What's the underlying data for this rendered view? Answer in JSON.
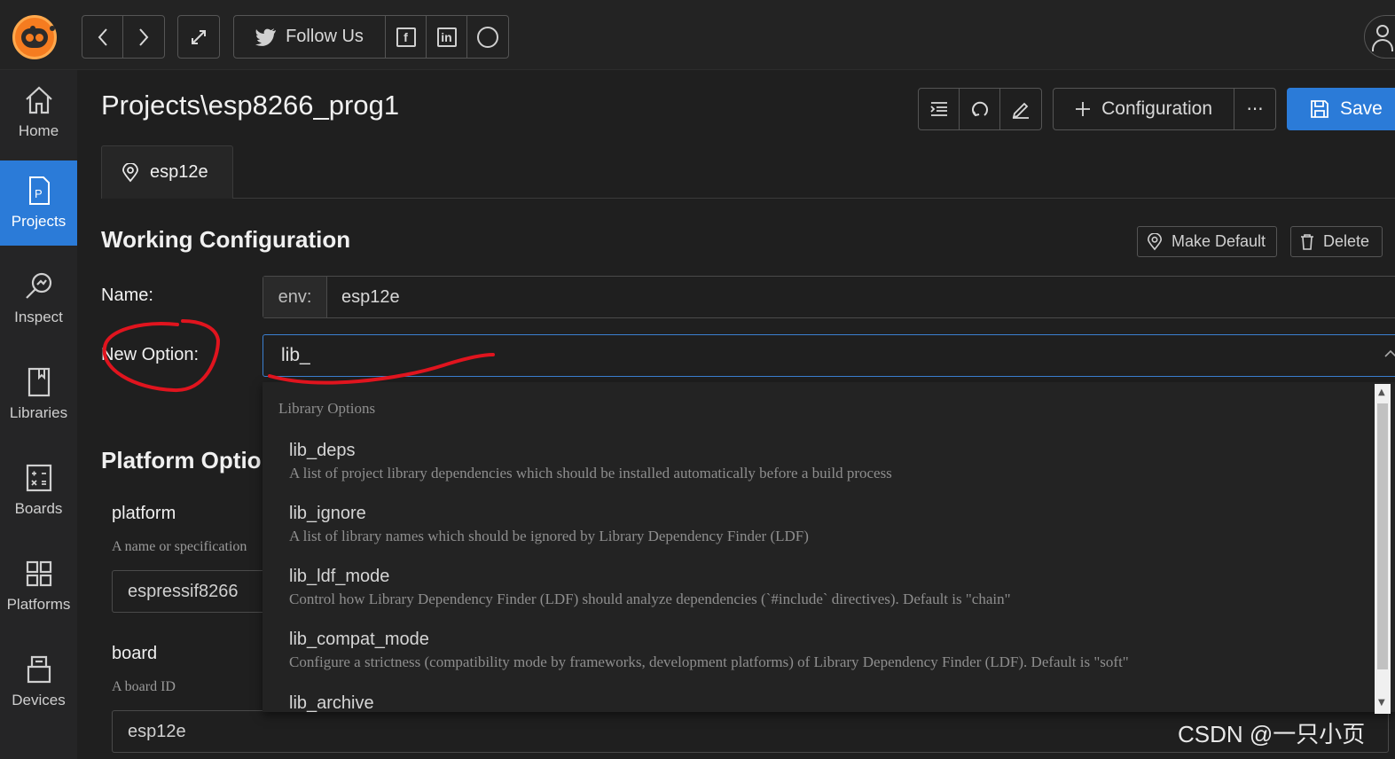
{
  "topbar": {
    "back_icon": "chevron-left-icon",
    "forward_icon": "chevron-right-icon",
    "fullscreen_icon": "expand-icon",
    "follow_label": "Follow Us",
    "social_icons": [
      "facebook-icon",
      "linkedin-icon",
      "github-icon"
    ],
    "user_icon": "user-icon"
  },
  "sidebar": {
    "items": [
      {
        "label": "Home",
        "icon": "home-icon"
      },
      {
        "label": "Projects",
        "icon": "project-file-icon",
        "active": true
      },
      {
        "label": "Inspect",
        "icon": "inspect-icon"
      },
      {
        "label": "Libraries",
        "icon": "book-icon"
      },
      {
        "label": "Boards",
        "icon": "calculator-icon"
      },
      {
        "label": "Platforms",
        "icon": "grid-icon"
      },
      {
        "label": "Devices",
        "icon": "device-icon"
      }
    ],
    "active_color": "#2b7bd8"
  },
  "main": {
    "title": "Projects\\esp8266_prog1",
    "toolbar": {
      "configuration_label": "Configuration",
      "more_label": "···",
      "save_label": "Save"
    },
    "env_tab": "esp12e",
    "working_config": {
      "title": "Working Configuration",
      "make_default_label": "Make Default",
      "delete_label": "Delete",
      "name_label": "Name:",
      "name_prefix": "env:",
      "name_value": "esp12e",
      "new_option_label": "New Option:",
      "new_option_value": "lib_"
    },
    "platform_options": {
      "title": "Platform Options",
      "platform_name": "platform",
      "platform_desc": "A name or specification",
      "platform_value": "espressif8266",
      "board_name": "board",
      "board_desc": "A board ID",
      "board_value": "esp12e"
    }
  },
  "dropdown": {
    "group_label": "Library Options",
    "items": [
      {
        "name": "lib_deps",
        "desc": "A list of project library dependencies which should be installed automatically before a build process"
      },
      {
        "name": "lib_ignore",
        "desc": "A list of library names which should be ignored by Library Dependency Finder (LDF)"
      },
      {
        "name": "lib_ldf_mode",
        "desc": "Control how Library Dependency Finder (LDF) should analyze dependencies (`#include` directives). Default is \"chain\""
      },
      {
        "name": "lib_compat_mode",
        "desc": "Configure a strictness (compatibility mode by frameworks, development platforms) of Library Dependency Finder (LDF). Default is \"soft\""
      },
      {
        "name": "lib_archive",
        "desc": ""
      }
    ]
  },
  "watermark": "CSDN @一只小页",
  "colors": {
    "accent": "#2b7bd8",
    "annotation": "#e0141e",
    "logo": "#f57c20"
  }
}
